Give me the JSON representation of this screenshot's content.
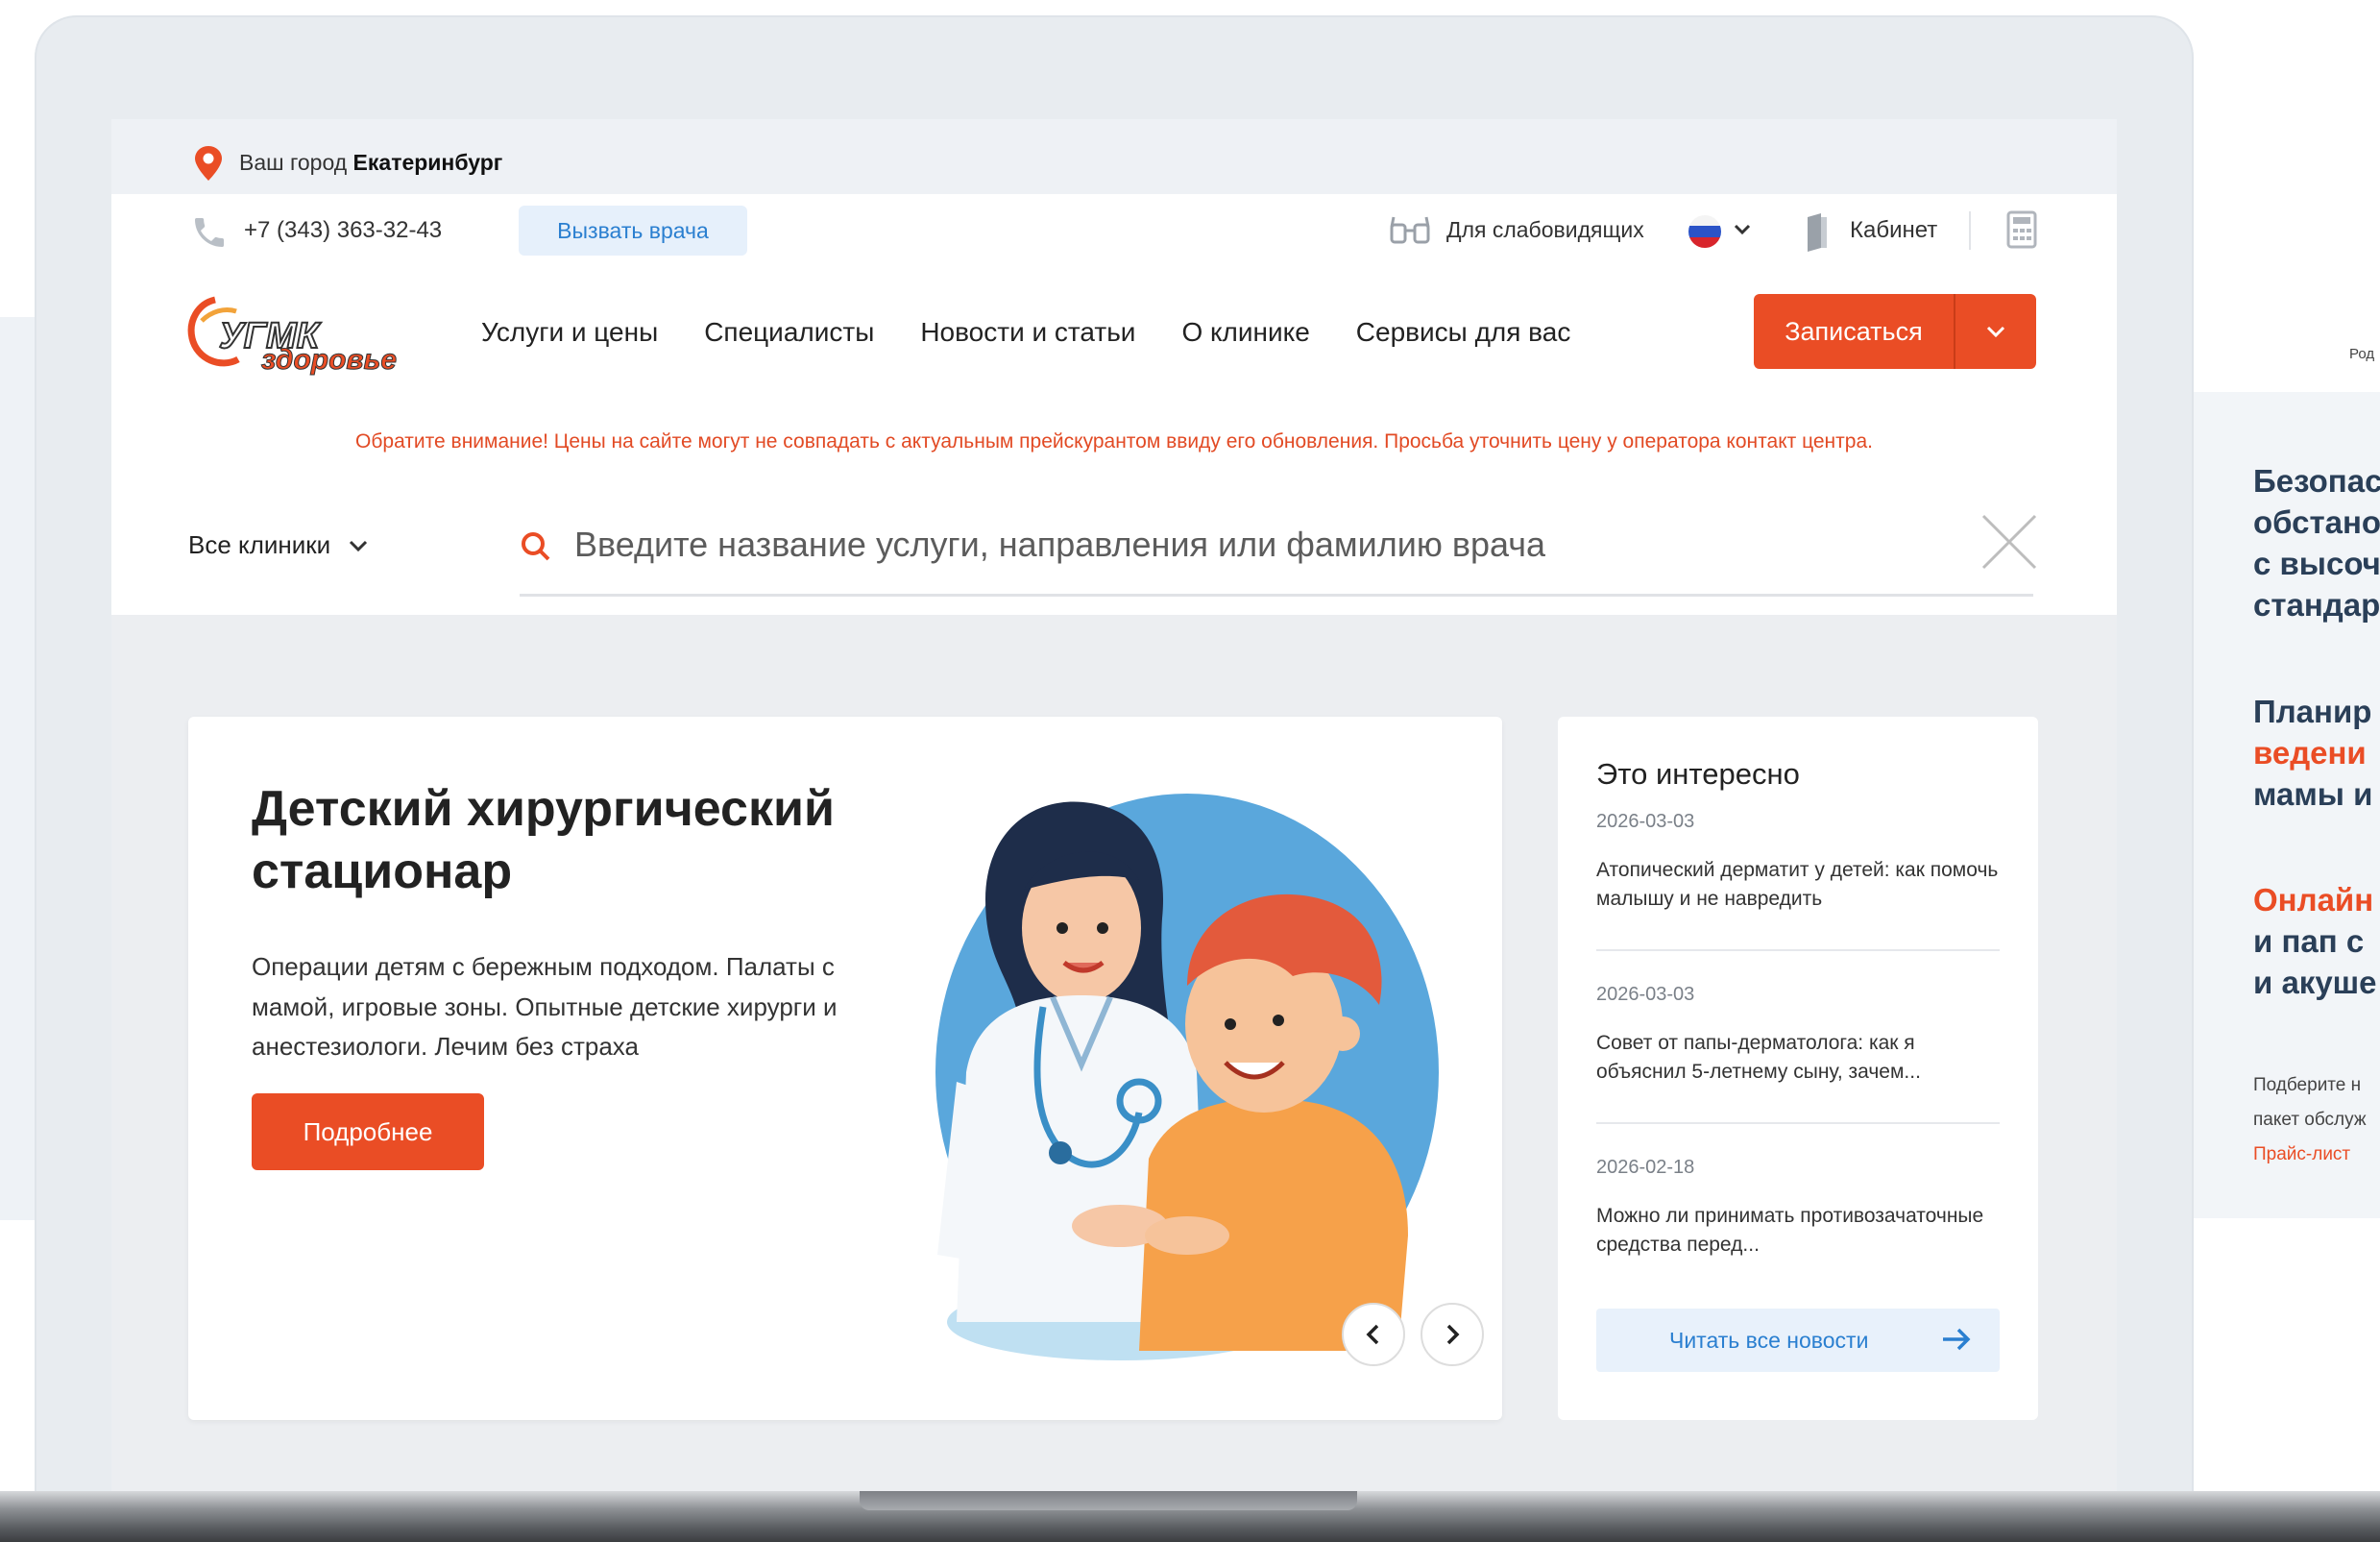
{
  "citybar": {
    "label": "Ваш город ",
    "city": "Екатеринбург"
  },
  "contacts": {
    "phone": "+7 (343) 363-32-43",
    "call_doctor": "Вызвать врача",
    "low_vision": "Для слабовидящих",
    "cabinet": "Кабинет"
  },
  "nav": {
    "items": [
      "Услуги и цены",
      "Специалисты",
      "Новости и статьи",
      "О клинике",
      "Сервисы для вас"
    ],
    "signup": "Записаться"
  },
  "logo": {
    "line1": "УГМК",
    "line2": "здоровье"
  },
  "notice": "Обратите внимание! Цены на сайте могут не совпадать с актуальным прейскурантом ввиду его обновления. Просьба уточнить цену у оператора контакт центра.",
  "search": {
    "clinics": "Все клиники",
    "placeholder": "Введите название услуги, направления или фамилию врача"
  },
  "hero": {
    "title": "Детский хирургический стационар",
    "description": "Операции детям с бережным подходом. Палаты с мамой, игровые зоны. Опытные детские хирурги и анестезиологи. Лечим без страха",
    "button": "Подробнее"
  },
  "news": {
    "title": "Это интересно",
    "items": [
      {
        "date": "2026-03-03",
        "text": "Атопический дерматит у детей: как помочь малышу и не навредить"
      },
      {
        "date": "2026-03-03",
        "text": "Совет от папы-дерматолога: как я объяснил 5-летнему сыну, зачем..."
      },
      {
        "date": "2026-02-18",
        "text": "Можно ли принимать противозачаточные средства перед..."
      }
    ],
    "read_all": "Читать все новости"
  },
  "right_panel": {
    "top_label": "Род",
    "h1": [
      "Безопас",
      "обстано",
      "с высоч",
      "стандар"
    ],
    "h2_line1": "Планир",
    "h2_line2": "ведени",
    "h2_line3": "мамы и",
    "h3_line1": "Онлайн",
    "h3_line2": "и пап с",
    "h3_line3": "и акуше",
    "small1": "Подберите н",
    "small2": "пакет обслуж",
    "price": "Прайс-лист"
  },
  "colors": {
    "accent": "#ea4d25",
    "link": "#2a7fd0",
    "navy": "#2a3f58"
  }
}
